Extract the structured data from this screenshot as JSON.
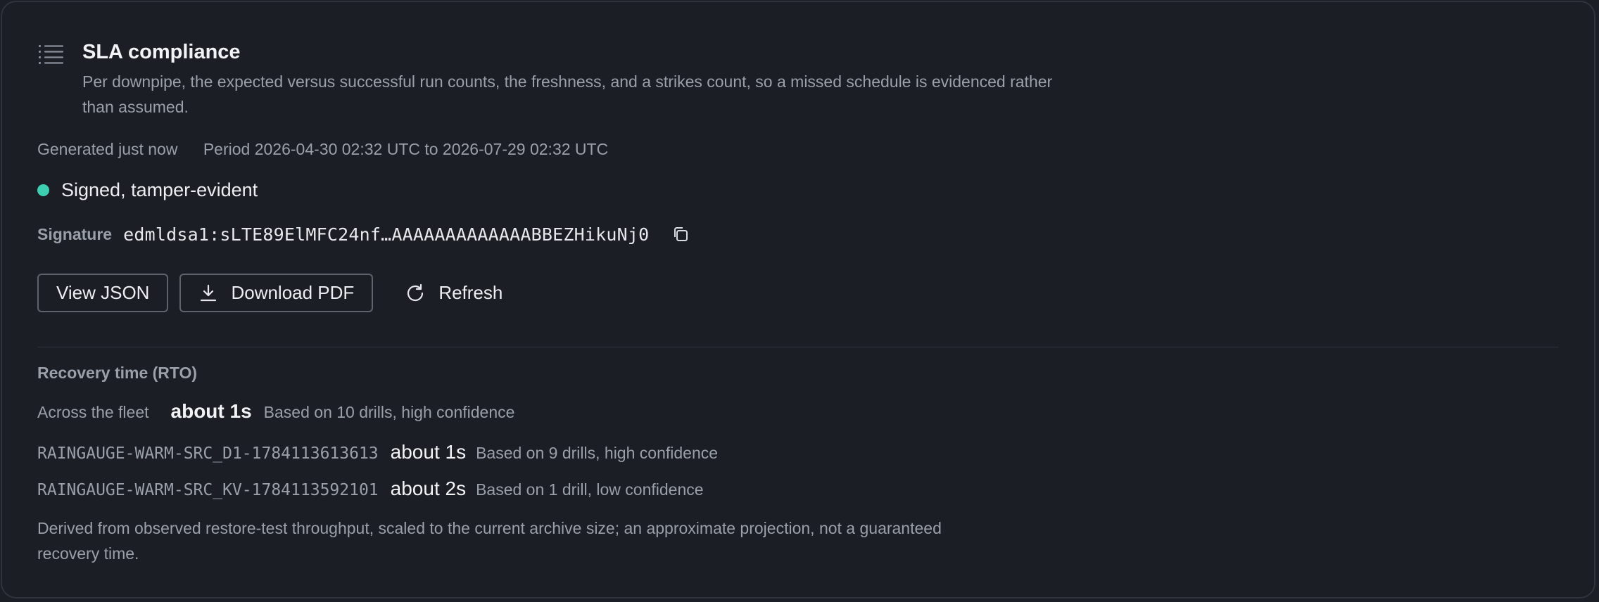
{
  "report": {
    "title": "SLA compliance",
    "description": "Per downpipe, the expected versus successful run counts, the freshness, and a strikes count, so a missed schedule is evidenced rather than assumed.",
    "generated": "Generated just now",
    "period": "Period 2026-04-30 02:32 UTC to 2026-07-29 02:32 UTC",
    "signed_status": "Signed, tamper-evident",
    "signature_label": "Signature",
    "signature_value": "edmldsa1:sLTE89ElMFC24nf…AAAAAAAAAAAAABBEZHikuNj0"
  },
  "actions": {
    "view_json": "View JSON",
    "download_pdf": "Download PDF",
    "refresh": "Refresh"
  },
  "rto": {
    "title": "Recovery time (RTO)",
    "fleet_label": "Across the fleet",
    "fleet_value": "about 1s",
    "fleet_basis": "Based on 10 drills, high confidence",
    "pipelines": [
      {
        "name": "RAINGAUGE-WARM-SRC_D1-1784113613613",
        "value": "about 1s",
        "basis": "Based on 9 drills, high confidence"
      },
      {
        "name": "RAINGAUGE-WARM-SRC_KV-1784113592101",
        "value": "about 2s",
        "basis": "Based on 1 drill, low confidence"
      }
    ],
    "footnote": "Derived from observed restore-test throughput, scaled to the current archive size; an approximate projection, not a guaranteed recovery time."
  },
  "colors": {
    "background": "#1b1e25",
    "signed_dot": "#3ecfb2",
    "muted_text": "#9aa0a9"
  },
  "icons": {
    "header": "list-icon",
    "copy": "copy-icon",
    "download": "download-icon",
    "refresh": "refresh-icon"
  }
}
